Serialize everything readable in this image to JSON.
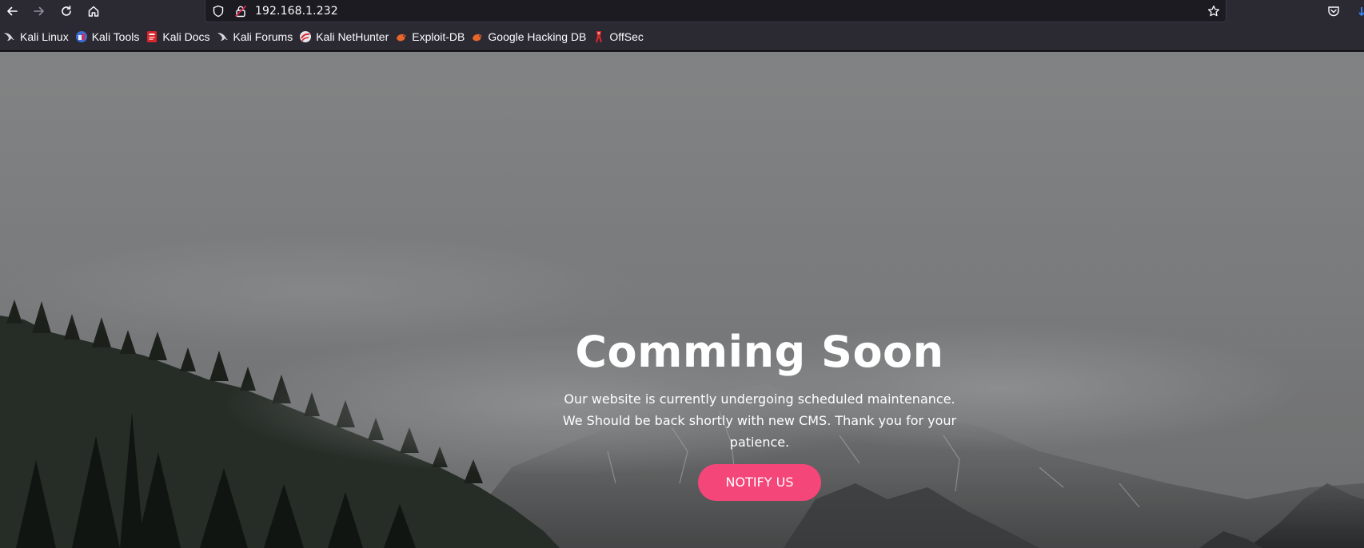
{
  "browser": {
    "url": "192.168.1.232",
    "nav_icons": [
      "back-arrow-icon",
      "forward-arrow-icon",
      "reload-icon",
      "home-icon"
    ],
    "url_icons": [
      "shield-icon",
      "insecure-lock-icon",
      "star-icon"
    ],
    "toolbar_right_icons": [
      "pocket-icon"
    ]
  },
  "bookmarks": [
    {
      "label": "Kali Linux",
      "icon": "kali-dragon-icon"
    },
    {
      "label": "Kali Tools",
      "icon": "kali-tools-icon"
    },
    {
      "label": "Kali Docs",
      "icon": "kali-docs-icon"
    },
    {
      "label": "Kali Forums",
      "icon": "kali-dragon-icon"
    },
    {
      "label": "Kali NetHunter",
      "icon": "nethunter-icon"
    },
    {
      "label": "Exploit-DB",
      "icon": "exploit-db-icon"
    },
    {
      "label": "Google Hacking DB",
      "icon": "exploit-db-icon"
    },
    {
      "label": "OffSec",
      "icon": "offsec-icon"
    }
  ],
  "page": {
    "title": "Comming Soon",
    "message": "Our website is currently undergoing scheduled maintenance. We Should be back shortly with new CMS. Thank you for your patience.",
    "button_label": "NOTIFY US",
    "accent_color": "#f5467a"
  }
}
